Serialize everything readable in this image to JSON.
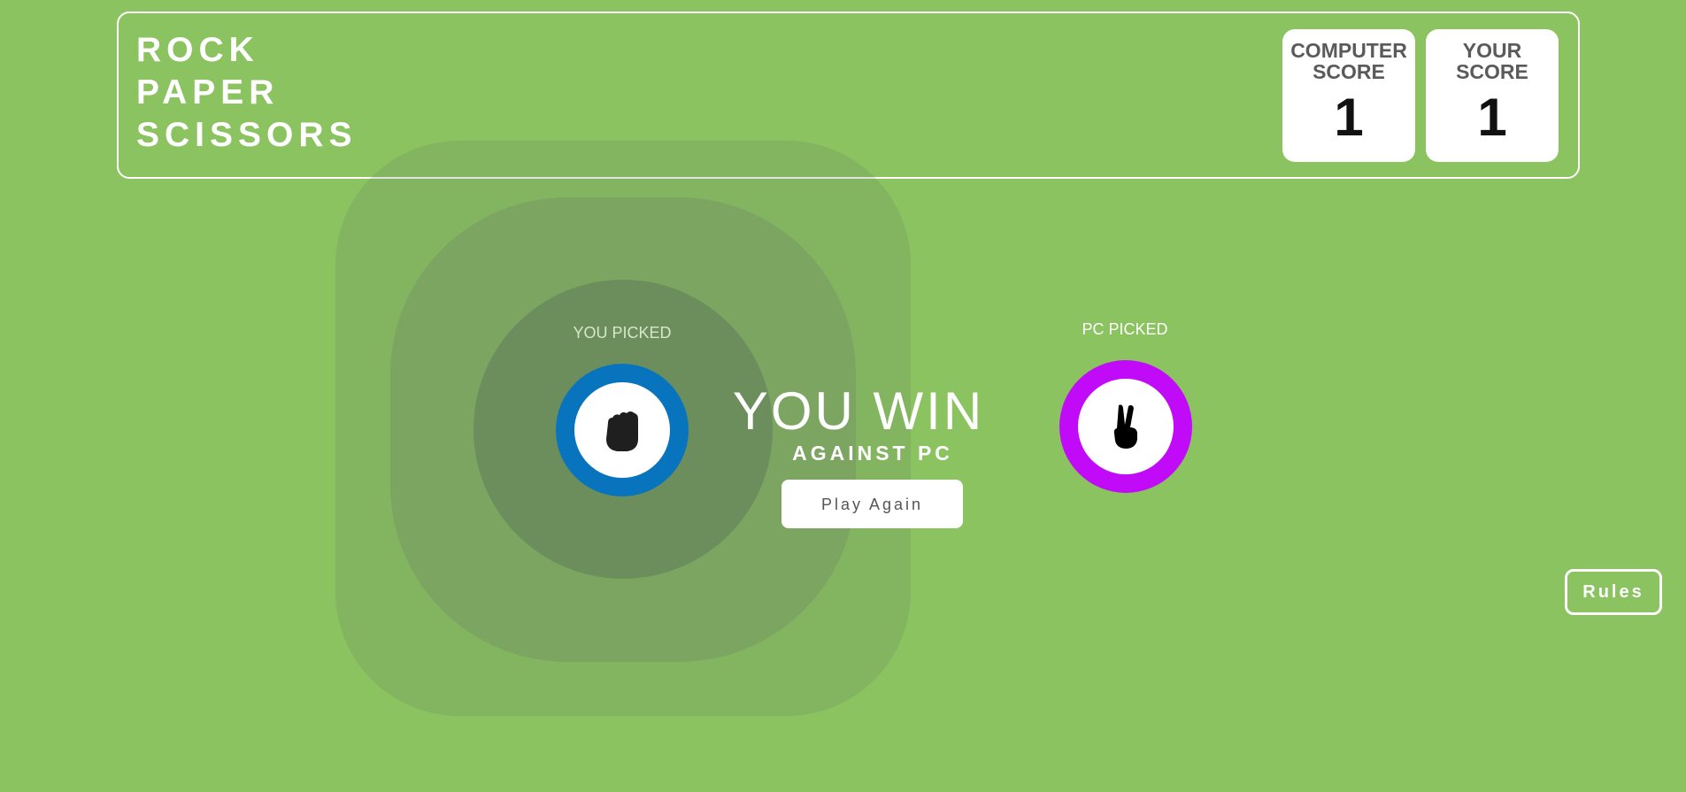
{
  "header": {
    "title_lines": [
      "ROCK",
      "PAPER",
      "SCISSORS"
    ],
    "computer_score": {
      "label_line1": "COMPUTER",
      "label_line2": "SCORE",
      "value": "1"
    },
    "your_score": {
      "label_line1": "YOUR",
      "label_line2": "SCORE",
      "value": "1"
    }
  },
  "game": {
    "you_picked_label": "YOU PICKED",
    "pc_picked_label": "PC PICKED",
    "you_choice": {
      "name": "rock",
      "icon": "fist-icon",
      "ring_color": "#0874be"
    },
    "pc_choice": {
      "name": "scissors",
      "icon": "peace-hand-icon",
      "ring_color": "#c10bf8"
    },
    "result_title": "YOU WIN",
    "result_subtitle": "AGAINST PC",
    "play_again_label": "Play Again"
  },
  "rules_label": "Rules",
  "colors": {
    "background": "#8ac35f",
    "rock_ring": "#0874be",
    "scissors_ring": "#c10bf8"
  }
}
